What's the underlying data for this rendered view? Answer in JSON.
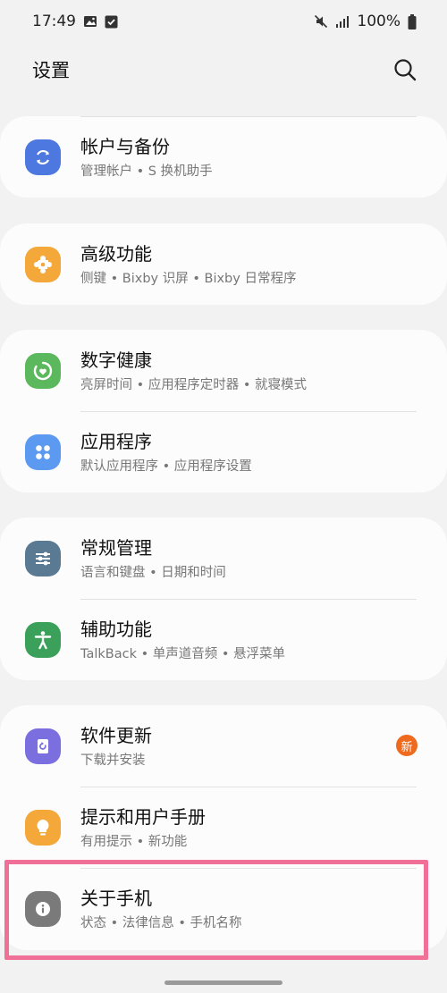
{
  "status_bar": {
    "time": "17:49",
    "battery": "100%"
  },
  "header": {
    "title": "设置"
  },
  "cards": [
    {
      "rows": [
        {
          "title": "帐户与备份",
          "subtitle": "管理帐户 • S 换机助手",
          "icon": "sync-icon",
          "color": "#4c78e0"
        }
      ]
    },
    {
      "rows": [
        {
          "title": "高级功能",
          "subtitle": "侧键 • Bixby 识屏 • Bixby 日常程序",
          "icon": "puzzle-icon",
          "color": "#f5a83a"
        }
      ]
    },
    {
      "rows": [
        {
          "title": "数字健康",
          "subtitle": "亮屏时间 • 应用程序定时器 • 就寝模式",
          "icon": "heart-ring-icon",
          "color": "#5cb85c"
        },
        {
          "title": "应用程序",
          "subtitle": "默认应用程序 • 应用程序设置",
          "icon": "apps-grid-icon",
          "color": "#5b9af0"
        }
      ]
    },
    {
      "rows": [
        {
          "title": "常规管理",
          "subtitle": "语言和键盘 • 日期和时间",
          "icon": "sliders-icon",
          "color": "#5a7a94"
        },
        {
          "title": "辅助功能",
          "subtitle": "TalkBack • 单声道音频 • 悬浮菜单",
          "icon": "accessibility-icon",
          "color": "#3aa05a"
        }
      ]
    },
    {
      "rows": [
        {
          "title": "软件更新",
          "subtitle": "下载并安装",
          "icon": "update-icon",
          "color": "#7b6fe0",
          "badge": "新"
        },
        {
          "title": "提示和用户手册",
          "subtitle": "有用提示 • 新功能",
          "icon": "lightbulb-icon",
          "color": "#f5a83a"
        },
        {
          "title": "关于手机",
          "subtitle": "状态 • 法律信息 • 手机名称",
          "icon": "info-icon",
          "color": "#7a7a7a"
        }
      ]
    }
  ]
}
